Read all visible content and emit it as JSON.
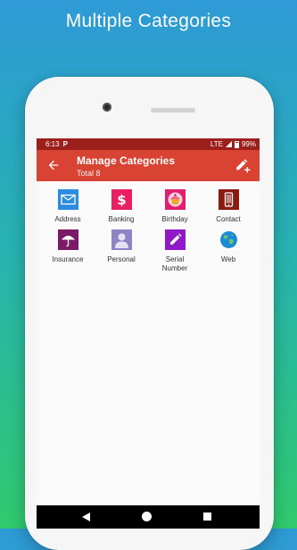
{
  "promo": {
    "title": "Multiple Categories"
  },
  "status_bar": {
    "time": "6:13",
    "app_mark": "P",
    "network": "LTE",
    "battery": "99%"
  },
  "app_bar": {
    "title": "Manage Categories",
    "subtitle": "Total 8"
  },
  "categories": [
    {
      "label": "Address",
      "icon": "envelope-icon",
      "color": "#2a8ce0"
    },
    {
      "label": "Banking",
      "icon": "dollar-icon",
      "color": "#e91e63"
    },
    {
      "label": "Birthday",
      "icon": "cupcake-icon",
      "color": "#e01e6d"
    },
    {
      "label": "Contact",
      "icon": "phone-icon",
      "color": "#8b1a12"
    },
    {
      "label": "Insurance",
      "icon": "umbrella-icon",
      "color": "#7b1a66"
    },
    {
      "label": "Personal",
      "icon": "person-icon",
      "color": "#8e84c5"
    },
    {
      "label": "Serial\nNumber",
      "icon": "pencil-icon",
      "color": "#8f18c9"
    },
    {
      "label": "Web",
      "icon": "globe-icon",
      "color": "#1c8ad6"
    }
  ],
  "colors": {
    "status_bar": "#9c1f1b",
    "app_bar": "#d84334",
    "background_top": "#2e9ad6",
    "background_bottom": "#2fca6e"
  }
}
